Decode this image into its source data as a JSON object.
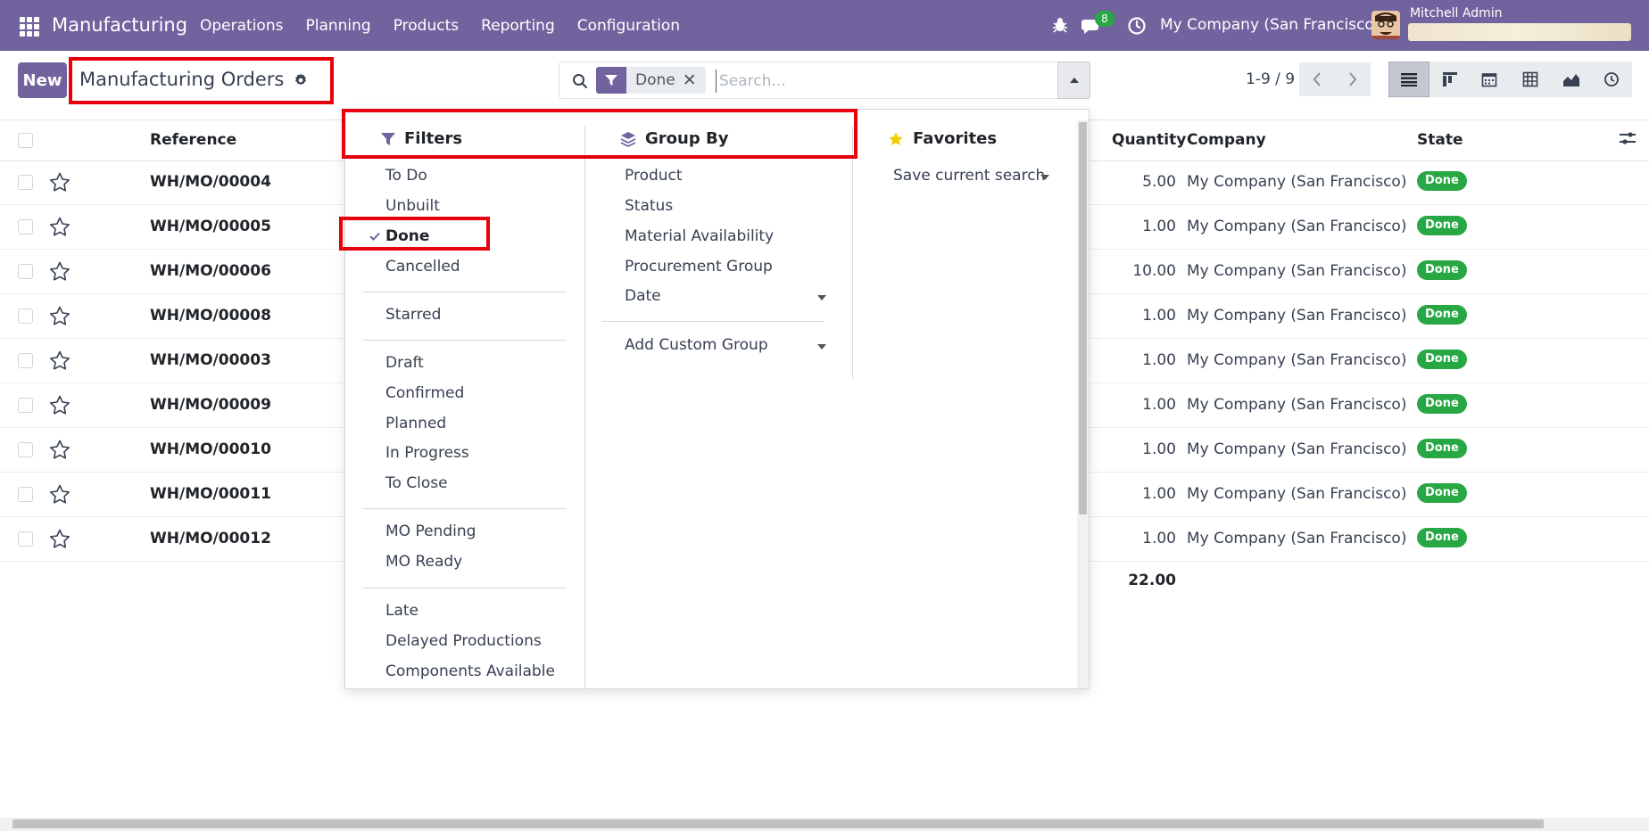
{
  "navbar": {
    "app_name": "Manufacturing",
    "menu": [
      "Operations",
      "Planning",
      "Products",
      "Reporting",
      "Configuration"
    ],
    "chat_count": "8",
    "company": "My Company (San Francisco)",
    "user_name": "Mitchell Admin"
  },
  "control": {
    "new_label": "New",
    "title": "Manufacturing Orders",
    "search": {
      "facet_value": "Done",
      "facet_close": "✕",
      "placeholder": "Search..."
    },
    "pager": "1-9 / 9"
  },
  "table": {
    "headers": {
      "reference": "Reference",
      "quantity": "Quantity",
      "company": "Company",
      "state": "State"
    },
    "rows": [
      {
        "ref": "WH/MO/00004",
        "qty": "5.00",
        "company": "My Company (San Francisco)",
        "state": "Done"
      },
      {
        "ref": "WH/MO/00005",
        "qty": "1.00",
        "company": "My Company (San Francisco)",
        "state": "Done"
      },
      {
        "ref": "WH/MO/00006",
        "qty": "10.00",
        "company": "My Company (San Francisco)",
        "state": "Done"
      },
      {
        "ref": "WH/MO/00008",
        "qty": "1.00",
        "company": "My Company (San Francisco)",
        "state": "Done"
      },
      {
        "ref": "WH/MO/00003",
        "qty": "1.00",
        "company": "My Company (San Francisco)",
        "state": "Done"
      },
      {
        "ref": "WH/MO/00009",
        "qty": "1.00",
        "company": "My Company (San Francisco)",
        "state": "Done"
      },
      {
        "ref": "WH/MO/00010",
        "qty": "1.00",
        "company": "My Company (San Francisco)",
        "state": "Done"
      },
      {
        "ref": "WH/MO/00011",
        "qty": "1.00",
        "company": "My Company (San Francisco)",
        "state": "Done"
      },
      {
        "ref": "WH/MO/00012",
        "qty": "1.00",
        "company": "My Company (San Francisco)",
        "state": "Done"
      }
    ],
    "total_qty": "22.00"
  },
  "dropdown": {
    "filters": {
      "title": "Filters",
      "items": [
        "To Do",
        "Unbuilt",
        "Done",
        "Cancelled",
        "Starred",
        "Draft",
        "Confirmed",
        "Planned",
        "In Progress",
        "To Close",
        "MO Pending",
        "MO Ready",
        "Late",
        "Delayed Productions",
        "Components Available"
      ],
      "selected": "Done"
    },
    "group_by": {
      "title": "Group By",
      "items": [
        "Product",
        "Status",
        "Material Availability",
        "Procurement Group",
        "Date"
      ],
      "custom": "Add Custom Group"
    },
    "favorites": {
      "title": "Favorites",
      "save": "Save current search"
    }
  },
  "colors": {
    "brand": "#71639e",
    "done_badge": "#28a745",
    "highlight": "#e8000d"
  }
}
